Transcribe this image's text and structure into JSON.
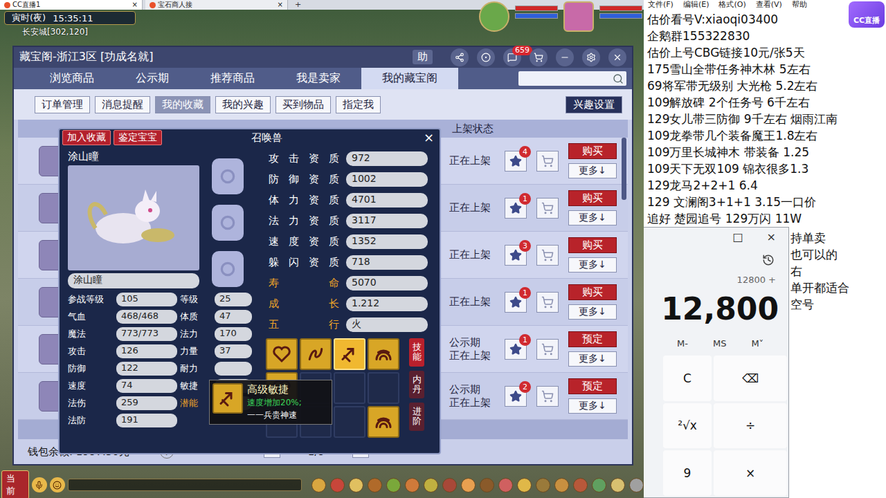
{
  "browser": {
    "tabs": [
      {
        "label": "CC直播1",
        "selected": true,
        "close": "×"
      },
      {
        "label": "宝石商人接",
        "selected": false,
        "close": "×"
      }
    ],
    "new_tab": "+"
  },
  "hud": {
    "time": "寅时(夜)",
    "clock": "15:35:11",
    "location": "长安城[302,120]",
    "status_bars": [
      {
        "level": 1.0,
        "color": "#d02828"
      },
      {
        "level": 1.0,
        "color": "#2f5fd8"
      },
      {
        "level": 1.0,
        "color": "#d02828"
      },
      {
        "level": 1.0,
        "color": "#2f5fd8"
      }
    ]
  },
  "cbg": {
    "title": "藏宝阁-浙江3区 [功成名就]",
    "help": "助",
    "message_count": "659",
    "tabs": [
      {
        "label": "浏览商品",
        "selected": false
      },
      {
        "label": "公示期",
        "selected": false
      },
      {
        "label": "推荐商品",
        "selected": false
      },
      {
        "label": "我是卖家",
        "selected": false
      },
      {
        "label": "我的藏宝阁",
        "selected": true
      }
    ],
    "subtabs": [
      {
        "label": "订单管理",
        "selected": false
      },
      {
        "label": "消息提醒",
        "selected": false
      },
      {
        "label": "我的收藏",
        "selected": true
      },
      {
        "label": "我的兴趣",
        "selected": false
      },
      {
        "label": "买到物品",
        "selected": false
      },
      {
        "label": "指定我",
        "selected": false
      }
    ],
    "interest_button": "兴趣设置",
    "columns": [
      "上架状态"
    ],
    "rows": [
      {
        "status": [
          "正在上架"
        ],
        "favorites": "4",
        "action": "购买",
        "more": "更多↓"
      },
      {
        "status": [
          "正在上架"
        ],
        "favorites": "1",
        "action": "购买",
        "more": "更多↓"
      },
      {
        "status": [
          "正在上架"
        ],
        "favorites": "3",
        "action": "购买",
        "more": "更多↓"
      },
      {
        "status": [
          "正在上架"
        ],
        "favorites": "1",
        "action": "购买",
        "more": "更多↓"
      },
      {
        "status": [
          "公示期",
          "正在上架"
        ],
        "favorites": "1",
        "action": "预定",
        "more": "更多↓"
      },
      {
        "status": [
          "公示期",
          "正在上架"
        ],
        "favorites": "2",
        "action": "预定",
        "more": "更多↓"
      }
    ],
    "wallet": "钱包余额: 1997.50元",
    "help_mark": "?",
    "pagination": {
      "prev": "<",
      "page": "1/9",
      "next": ">"
    }
  },
  "pet": {
    "buttons": [
      "加入收藏",
      "鉴定宝宝"
    ],
    "title": "召唤兽",
    "close": "×",
    "name": "涂山瞳",
    "name_field": "涂山瞳",
    "equipment_slots": [
      {
        "empty": true
      },
      {
        "empty": true
      },
      {
        "empty": true
      }
    ],
    "aptitudes": [
      {
        "label": "攻击资质",
        "value": "972",
        "highlight": false
      },
      {
        "label": "防御资质",
        "value": "1002",
        "highlight": false
      },
      {
        "label": "体力资质",
        "value": "4701",
        "highlight": false
      },
      {
        "label": "法力资质",
        "value": "3117",
        "highlight": false
      },
      {
        "label": "速度资质",
        "value": "1352",
        "highlight": false
      },
      {
        "label": "躲闪资质",
        "value": "718",
        "highlight": false
      },
      {
        "label": "寿命",
        "value": "5070",
        "highlight": true
      },
      {
        "label": "成长",
        "value": "1.212",
        "highlight": true
      },
      {
        "label": "五行",
        "value": "火",
        "highlight": true
      }
    ],
    "stats": [
      {
        "left": {
          "label": "参战等级",
          "value": "105",
          "highlight": false
        },
        "right": {
          "label": "等级",
          "value": "25",
          "highlight": false
        }
      },
      {
        "left": {
          "label": "气血",
          "value": "468/468",
          "highlight": false
        },
        "right": {
          "label": "体质",
          "value": "47",
          "highlight": false
        }
      },
      {
        "left": {
          "label": "魔法",
          "value": "773/773",
          "highlight": false
        },
        "right": {
          "label": "法力",
          "value": "170",
          "highlight": false
        }
      },
      {
        "left": {
          "label": "攻击",
          "value": "126",
          "highlight": false
        },
        "right": {
          "label": "力量",
          "value": "37",
          "highlight": false
        }
      },
      {
        "left": {
          "label": "防御",
          "value": "122",
          "highlight": false
        },
        "right": {
          "label": "耐力",
          "value": "",
          "highlight": false
        }
      },
      {
        "left": {
          "label": "速度",
          "value": "74",
          "highlight": false
        },
        "right": {
          "label": "敏捷",
          "value": "",
          "highlight": false
        }
      },
      {
        "left": {
          "label": "法伤",
          "value": "259",
          "highlight": false
        },
        "right": {
          "label": "潜能",
          "value": "",
          "highlight": true
        }
      },
      {
        "left": {
          "label": "法防",
          "value": "191",
          "highlight": false
        },
        "right": null
      }
    ],
    "skills": [
      {
        "filled": true,
        "selected": false
      },
      {
        "filled": true,
        "selected": false
      },
      {
        "filled": true,
        "selected": true
      },
      {
        "filled": true,
        "selected": false
      },
      {
        "filled": true,
        "selected": false
      },
      {
        "filled": false,
        "selected": false
      },
      {
        "filled": false,
        "selected": false
      },
      {
        "filled": false,
        "selected": false
      },
      {
        "filled": false,
        "selected": false
      },
      {
        "filled": false,
        "selected": false
      },
      {
        "filled": false,
        "selected": false
      },
      {
        "filled": true,
        "selected": false
      }
    ],
    "side_buttons": [
      {
        "label": "技能",
        "selected": true
      },
      {
        "label": "内丹",
        "selected": false
      },
      {
        "label": "进阶",
        "selected": false
      }
    ],
    "tooltip": {
      "title": "高级敏捷",
      "effect": "速度增加20%;",
      "note": "一一兵贵神速"
    }
  },
  "game_bar": {
    "channel": "当前"
  },
  "notepad": {
    "menu": [
      "文件(F)",
      "编辑(E)",
      "格式(O)",
      "查看(V)",
      "帮助"
    ],
    "lines": [
      "估价看号V:xiaoqi03400",
      "企鹅群155322830",
      "估价上号CBG链接10元/张5天",
      "175雪山全带任务神木林 5左右",
      "69将军带无级别 大光枪 5.2左右",
      "109解放碑 2个任务号 6千左右",
      "129女儿带三防御 9千左右 烟雨江南",
      "109龙拳带几个装备魔王1.8左右",
      "109万里长城神木 带装备  1.25",
      "109天下无双109  锦衣很多1.3",
      "129龙马2+2+1  6.4",
      "129 文澜阁3+1+1   3.15一口价",
      "追好 楚园追号 129万闪 11W"
    ],
    "covered_fragments": [
      "持单卖",
      "也可以的",
      "右",
      "单开都适合",
      "空号"
    ]
  },
  "calculator": {
    "window_buttons": [
      "□",
      "×"
    ],
    "expression": "12800 +",
    "display": "12,800",
    "memory": [
      "M-",
      "MS",
      "M˅"
    ],
    "keys": [
      "C",
      "⌫",
      "²√x",
      "÷",
      "9",
      "×"
    ]
  },
  "logo": "CC直播"
}
